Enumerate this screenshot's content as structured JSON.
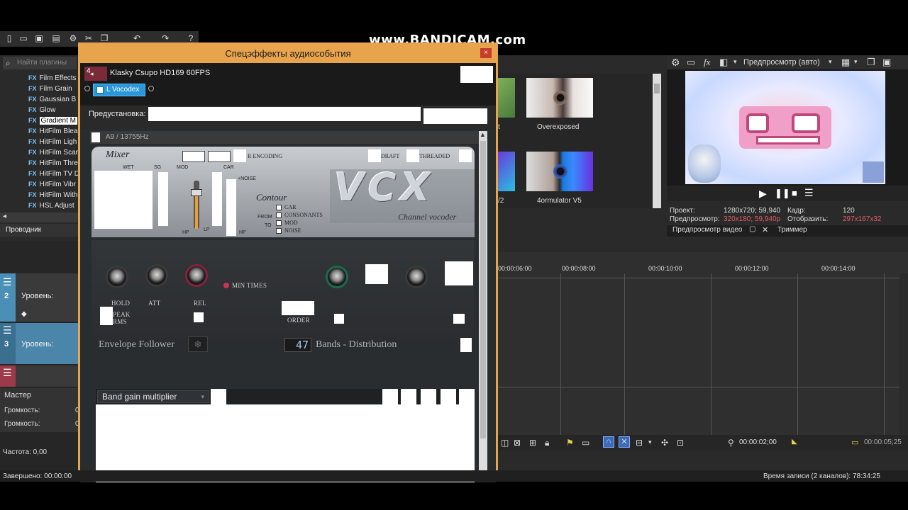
{
  "watermark": "www.BANDICAM.com",
  "plugins": {
    "search_placeholder": "Найти плагины",
    "items": [
      "Film Effects",
      "Film Grain",
      "Gaussian B",
      "Glow",
      "Gradient M",
      "HitFilm Blea",
      "HitFilm Ligh",
      "HitFilm Scar",
      "HitFilm Thre",
      "HitFilm TV D",
      "HitFilm Vibr",
      "HitFilm With",
      "HSL Adjust"
    ],
    "fx_label": "FX",
    "selected_index": 4
  },
  "explorer_tab": "Проводник",
  "tracks": {
    "track2_num": "2",
    "track2_level": "Уровень:",
    "track3_num": "3",
    "track3_level": "Уровень:",
    "master": "Мастер",
    "volume1": "Громкость:",
    "volume2": "Громкость:",
    "volume_val1": "0",
    "volume_val2": "0",
    "frequency": "Частота: 0,00"
  },
  "fx_window": {
    "title": "Спецэффекты аудиособытия",
    "close": "×",
    "event_name": "Klasky Csupo HD169 60FPS",
    "plugin_chip": "L Vocodex",
    "preset_label": "Предустановка:",
    "panel_header": "A9 / 13755Hz"
  },
  "vocodex": {
    "mixer": "Mixer",
    "wet": "WET",
    "sg": "SG",
    "mod": "MOD",
    "car": "CAR",
    "noise_plus": "+NOISE",
    "encoding": "R ENCODING",
    "draft": "DRAFT",
    "threaded": "THREADED",
    "contour": "Contour",
    "from": "FROM",
    "to": "TO",
    "car_opt": "CAR",
    "consonants": "CONSONANTS",
    "mod_opt": "MOD",
    "noise_opt": "NOISE",
    "hp1": "HP",
    "lp": "LP",
    "hp2": "HP",
    "logo": "VCX",
    "subtitle": "Channel vocoder",
    "hold": "HOLD",
    "att": "ATT",
    "rel": "REL",
    "min_times": "MIN TIMES",
    "peak": "PEAK",
    "rms": "RMS",
    "order": "ORDER",
    "envelope_follower": "Envelope Follower",
    "bands_value": "47",
    "bands_distribution": "Bands - Distribution",
    "band_gain": "Band gain multiplier"
  },
  "fx_thumbs": {
    "overexposed": "Overexposed",
    "formulator": "4ormulator V5",
    "partial1": "t",
    "partial2": "/2"
  },
  "preview": {
    "mode": "Предпросмотр (авто)",
    "project_label": "Проект:",
    "project_value": "1280x720; 59,940",
    "frame_label": "Кадр:",
    "frame_value": "120",
    "preview_label": "Предпросмотр:",
    "preview_value": "320x180; 59,940p",
    "display_label": "Отобразить:",
    "display_value": "297x167x32",
    "tab_video": "Предпросмотр видео",
    "tab_trimmer": "Триммер"
  },
  "timeline": {
    "ticks": [
      "00:00:06:00",
      "00:00:08:00",
      "00:00:10:00",
      "00:00:12:00",
      "00:00:14:00"
    ],
    "position": "00:00:02;00",
    "end": "00:00:05;25"
  },
  "status": {
    "done": "Завершено: 00:00:00",
    "record_time": "Время записи (2 каналов): 78:34:25"
  }
}
